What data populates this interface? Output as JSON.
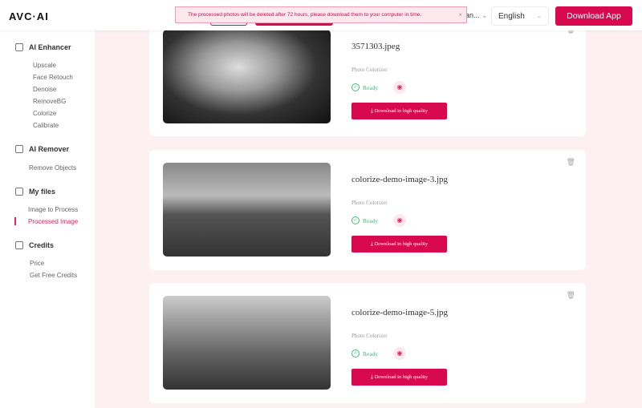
{
  "header": {
    "logo": "AVC·AI",
    "language_truncated": "an...",
    "language": "English",
    "download_app": "Download App"
  },
  "toast": {
    "message": "The processed photos will be deleted after 72 hours, please download them to your computer in time.",
    "close": "×"
  },
  "sidebar": {
    "ai_enhancer": {
      "title": "AI Enhancer",
      "items": [
        "Upscale",
        "Face Retouch",
        "Denoise",
        "RemoveBG",
        "Colorize",
        "Calibrate"
      ]
    },
    "ai_remover": {
      "title": "AI Remover",
      "items": [
        "Remove Objects"
      ]
    },
    "my_files": {
      "title": "My files",
      "items": [
        "Image to Process",
        "Processed Image"
      ],
      "active": "Processed Image"
    },
    "credits": {
      "title": "Credits",
      "items": [
        "Price",
        "Get Free Credits"
      ]
    }
  },
  "files": [
    {
      "name": "3571303.jpeg",
      "tool": "Photo Colorizer",
      "status": "Ready",
      "download": "Download in high quality"
    },
    {
      "name": "colorize-demo-image-3.jpg",
      "tool": "Photo Colorizer",
      "status": "Ready",
      "download": "Download in high quality"
    },
    {
      "name": "colorize-demo-image-5.jpg",
      "tool": "Photo Colorizer",
      "status": "Ready",
      "download": "Download in high quality"
    }
  ],
  "colors": {
    "accent": "#d8094f",
    "ready": "#3bbf7a",
    "background": "#fdf0f3"
  }
}
